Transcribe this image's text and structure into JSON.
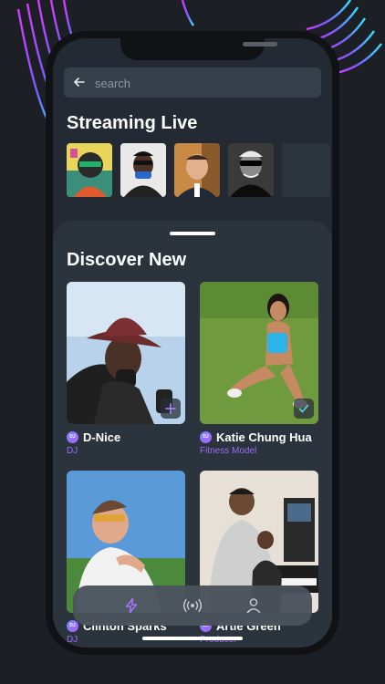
{
  "search": {
    "placeholder": "search"
  },
  "streaming": {
    "title": "Streaming Live",
    "tiles": [
      "avatar-artwork",
      "avatar-man-glasses",
      "avatar-man-suit",
      "avatar-man-sunglasses"
    ]
  },
  "discover": {
    "title": "Discover New",
    "cards": [
      {
        "name": "D-Nice",
        "role": "DJ",
        "badge": "DJ",
        "action": "plus-icon"
      },
      {
        "name": "Katie Chung Hua",
        "role": "Fitness Model",
        "badge": "DJ",
        "action": "check-icon"
      },
      {
        "name": "Clinton Sparks",
        "role": "DJ",
        "badge": "DJ"
      },
      {
        "name": "Artie Green",
        "role": "Producer",
        "badge": "DJ"
      }
    ]
  },
  "tabbar": {
    "items": [
      "lightning-icon",
      "broadcast-icon",
      "profile-icon"
    ],
    "active": "lightning-icon"
  },
  "colors": {
    "accent": "#9a6bff",
    "screen": "#232a33",
    "sheet": "#2b333d"
  }
}
